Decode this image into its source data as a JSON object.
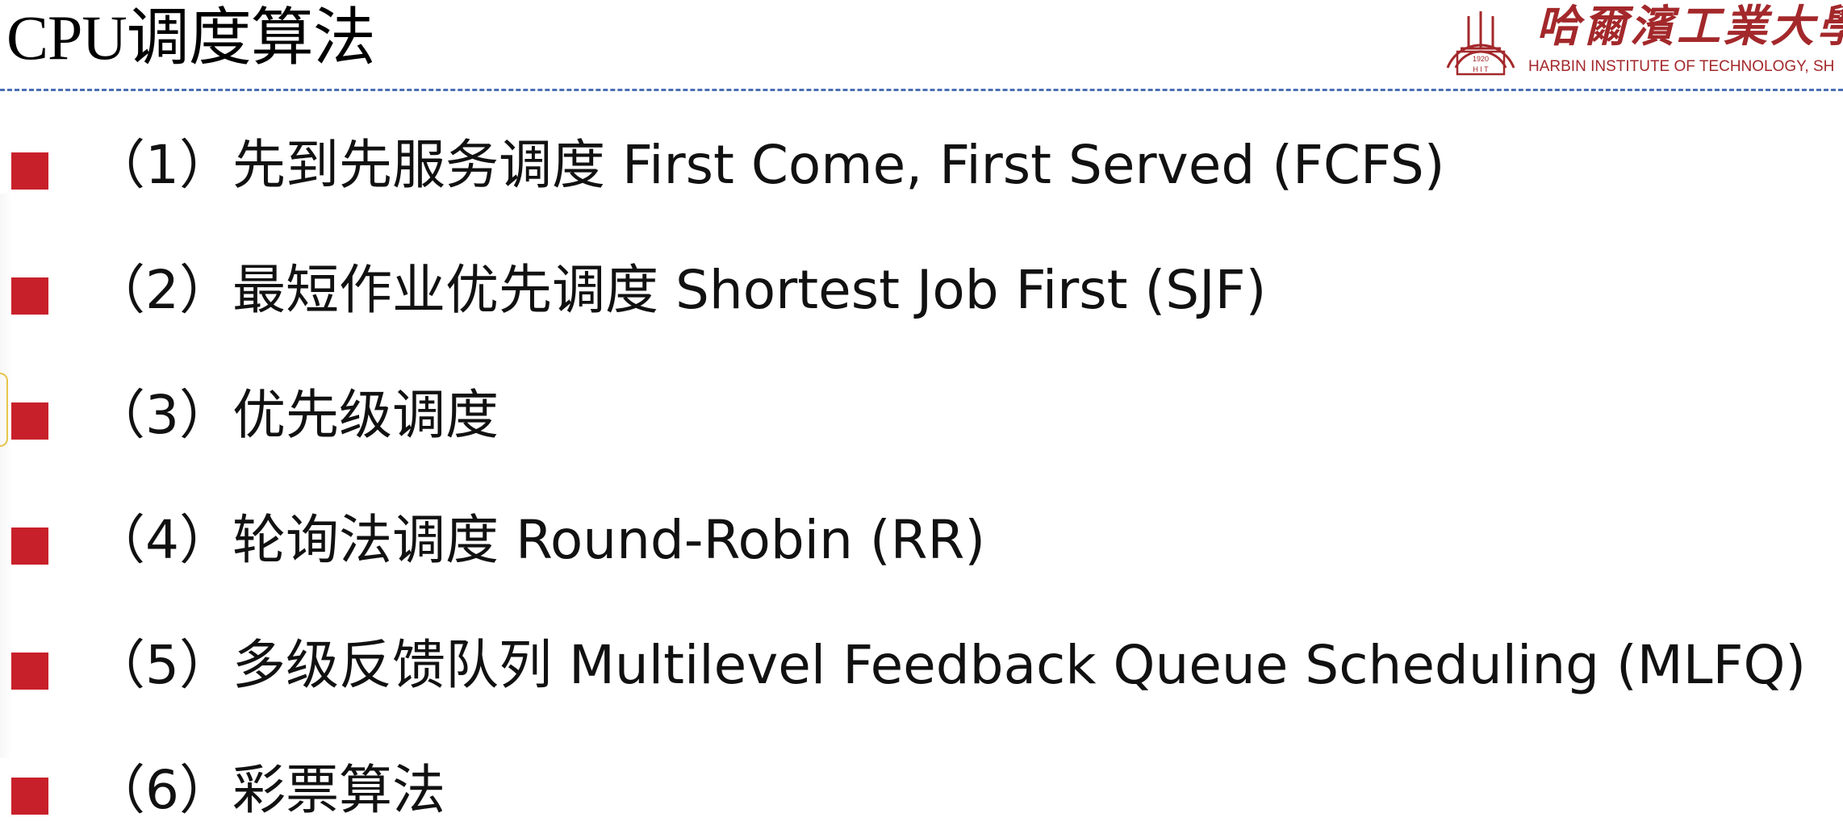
{
  "slide": {
    "title": "CPU调度算法",
    "logo": {
      "cn_name": "哈爾濱工業大學（",
      "en_name": "HARBIN INSTITUTE OF TECHNOLOGY, SH",
      "seal_year": "1920",
      "seal_letters": "H I T"
    },
    "colors": {
      "bullet": "#c8202a",
      "divider": "#4a6fb5",
      "logo": "#a3282b"
    },
    "items": [
      {
        "text": "（1）先到先服务调度 First Come, First Served (FCFS)"
      },
      {
        "text": "（2）最短作业优先调度 Shortest Job First (SJF)"
      },
      {
        "text": "（3）优先级调度"
      },
      {
        "text": "（4）轮询法调度 Round-Robin (RR)"
      },
      {
        "text": "（5）多级反馈队列 Multilevel Feedback Queue Scheduling (MLFQ)"
      },
      {
        "text": "（6）彩票算法"
      }
    ]
  }
}
